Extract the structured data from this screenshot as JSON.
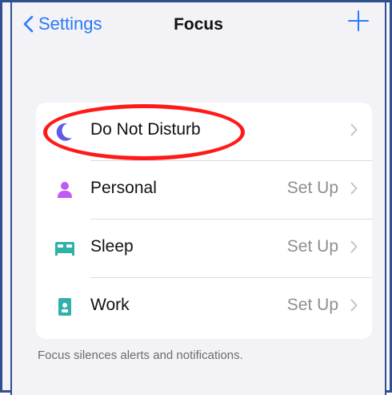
{
  "nav": {
    "back_label": "Settings",
    "title": "Focus",
    "add_icon": "plus-icon"
  },
  "focus_items": [
    {
      "label": "Do Not Disturb",
      "value": "",
      "icon": "moon-icon",
      "color": "#5e5ce6"
    },
    {
      "label": "Personal",
      "value": "Set Up",
      "icon": "person-icon",
      "color": "#bf5af2"
    },
    {
      "label": "Sleep",
      "value": "Set Up",
      "icon": "bed-icon",
      "color": "#30b0a8"
    },
    {
      "label": "Work",
      "value": "Set Up",
      "icon": "badge-icon",
      "color": "#30b0a8"
    }
  ],
  "footer_text": "Focus silences alerts and notifications.",
  "colors": {
    "accent": "#2a7af6",
    "annotation": "#ff1a1a",
    "background": "#f2f2f7"
  }
}
